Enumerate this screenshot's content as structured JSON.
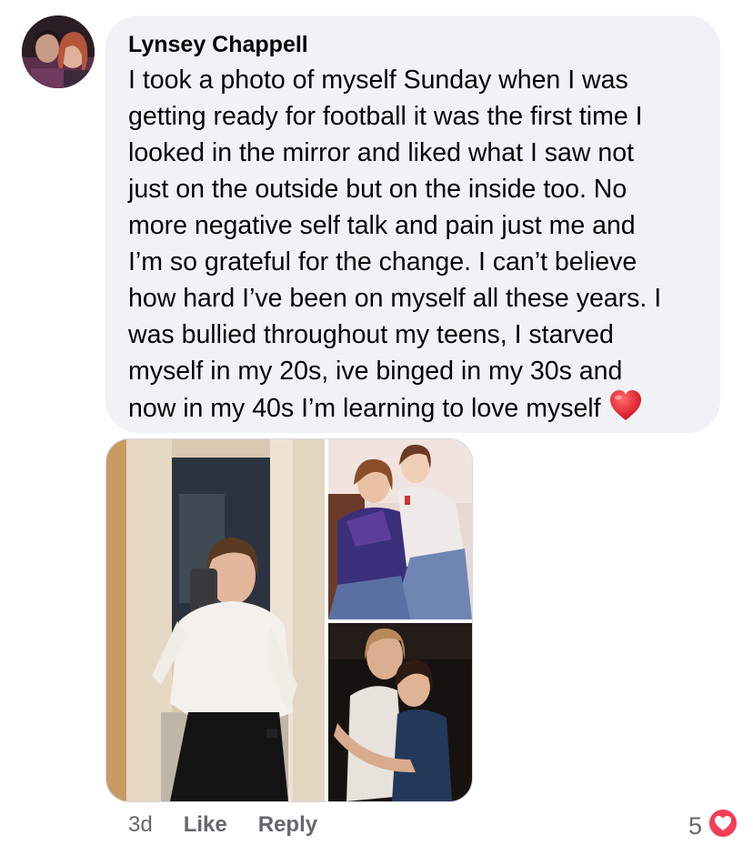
{
  "comment": {
    "author": "Lynsey Chappell",
    "text": "I took a photo of myself Sunday when I was\ngetting ready for football it was the first time I\nlooked in the mirror and liked what I saw not\njust on the outside but on the inside too. No\nmore negative self talk and pain just me and\nI’m so grateful for the change. I can’t believe\nhow hard I’ve been on myself all these years. I\nwas bullied throughout my teens, I starved\nmyself in my 20s, ive binged in my 30s and\nnow in my 40s I’m learning to love myself",
    "emoji": "red-heart-icon"
  },
  "actions": {
    "time": "3d",
    "like_label": "Like",
    "reply_label": "Reply"
  },
  "reactions": {
    "count": "5",
    "icon": "love-reaction-icon"
  },
  "colors": {
    "bubble": "#f0f2f5",
    "text": "#050505",
    "meta": "#65676b",
    "love": "#f33e58"
  }
}
